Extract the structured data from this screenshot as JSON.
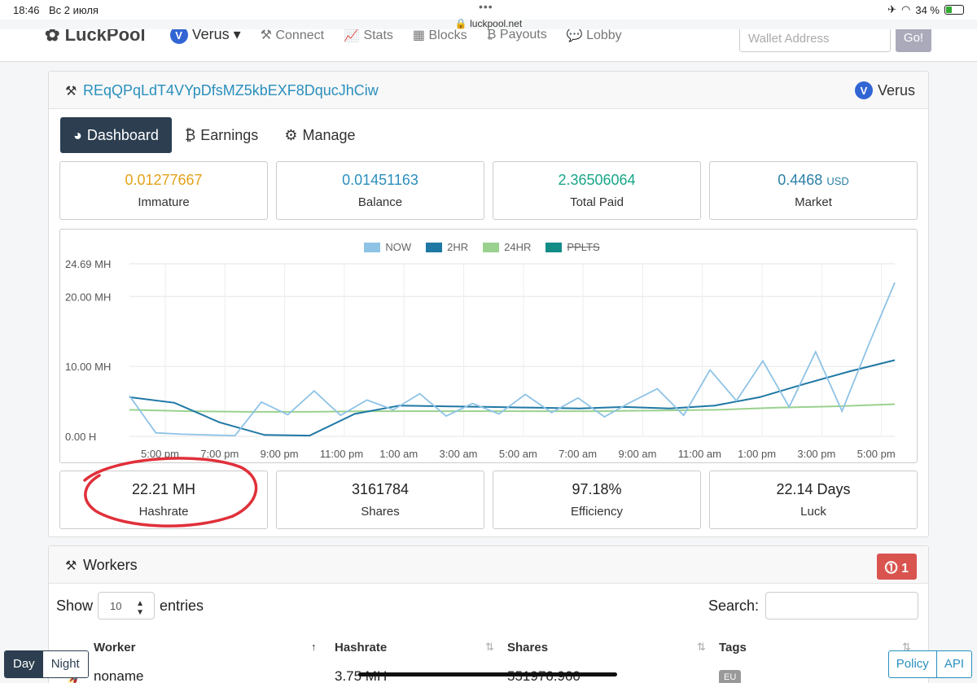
{
  "status_bar": {
    "time": "18:46",
    "date": "Вс 2 июля",
    "url": "luckpool.net",
    "battery": "34 %"
  },
  "navbar": {
    "brand": "LuckPool",
    "coin": "Verus",
    "items": [
      "Connect",
      "Stats",
      "Blocks",
      "Payouts",
      "Lobby"
    ],
    "wallet_placeholder": "Wallet Address",
    "go_label": "Go!"
  },
  "account": {
    "address": "REqQPqLdT4VYpDfsMZ5kbEXF8DqucJhCiw",
    "coin": "Verus"
  },
  "tabs": [
    "Dashboard",
    "Earnings",
    "Manage"
  ],
  "balances": [
    {
      "value": "0.01277667",
      "unit": "",
      "label": "Immature",
      "color": "#e3a21a"
    },
    {
      "value": "0.01451163",
      "unit": "",
      "label": "Balance",
      "color": "#2a8fbd"
    },
    {
      "value": "2.36506064",
      "unit": "",
      "label": "Total Paid",
      "color": "#18a689"
    },
    {
      "value": "0.4468",
      "unit": "USD",
      "label": "Market",
      "color": "#2a7fa6"
    }
  ],
  "chart_data": {
    "type": "line",
    "legend": [
      {
        "name": "NOW",
        "color": "#8ec3e6"
      },
      {
        "name": "2HR",
        "color": "#1f78a4"
      },
      {
        "name": "24HR",
        "color": "#9bd18f"
      },
      {
        "name": "PPLTS",
        "color": "#138c86"
      }
    ],
    "y_ticks": [
      "24.69 MH",
      "20.00 MH",
      "10.00 MH",
      "0.00 H"
    ],
    "ylim": [
      0,
      24.69
    ],
    "x_ticks": [
      "5:00 pm",
      "7:00 pm",
      "9:00 pm",
      "11:00 pm",
      "1:00 am",
      "3:00 am",
      "5:00 am",
      "7:00 am",
      "9:00 am",
      "11:00 am",
      "1:00 pm",
      "3:00 pm",
      "5:00 pm"
    ],
    "series": [
      {
        "name": "24HR",
        "values": [
          3.8,
          3.6,
          3.5,
          3.5,
          3.6,
          3.6,
          3.6,
          3.6,
          3.6,
          3.7,
          3.8,
          4.1,
          4.3,
          4.6
        ]
      },
      {
        "name": "2HR",
        "values": [
          5.6,
          4.8,
          2.0,
          0.2,
          0.1,
          3.2,
          4.4,
          4.3,
          4.2,
          4.1,
          4.0,
          4.2,
          4.0,
          4.4,
          5.6,
          7.5,
          9.3,
          10.9
        ]
      },
      {
        "name": "NOW",
        "values": [
          5.8,
          0.5,
          0.3,
          0.2,
          0.1,
          4.9,
          3.1,
          6.5,
          3.0,
          5.2,
          3.8,
          6.1,
          2.9,
          4.7,
          3.2,
          6.0,
          3.4,
          5.5,
          2.8,
          4.9,
          6.8,
          3.0,
          9.5,
          5.1,
          10.8,
          4.2,
          12.1,
          3.6,
          13.0,
          22.0
        ]
      }
    ]
  },
  "stats": [
    {
      "value": "22.21 MH",
      "label": "Hashrate"
    },
    {
      "value": "3161784",
      "label": "Shares"
    },
    {
      "value": "97.18%",
      "label": "Efficiency"
    },
    {
      "value": "22.14 Days",
      "label": "Luck"
    }
  ],
  "workers": {
    "title": "Workers",
    "alert_count": "1",
    "show_label": "Show",
    "page_size": "10",
    "entries_label": "entries",
    "search_label": "Search:",
    "columns": [
      "Worker",
      "Hashrate",
      "Shares",
      "Tags"
    ],
    "rows": [
      {
        "worker": "noname",
        "hashrate": "3.75 MH",
        "shares": "551976.960",
        "tag": "EU"
      }
    ]
  },
  "footer": {
    "day": "Day",
    "night": "Night",
    "policy": "Policy",
    "api": "API"
  }
}
